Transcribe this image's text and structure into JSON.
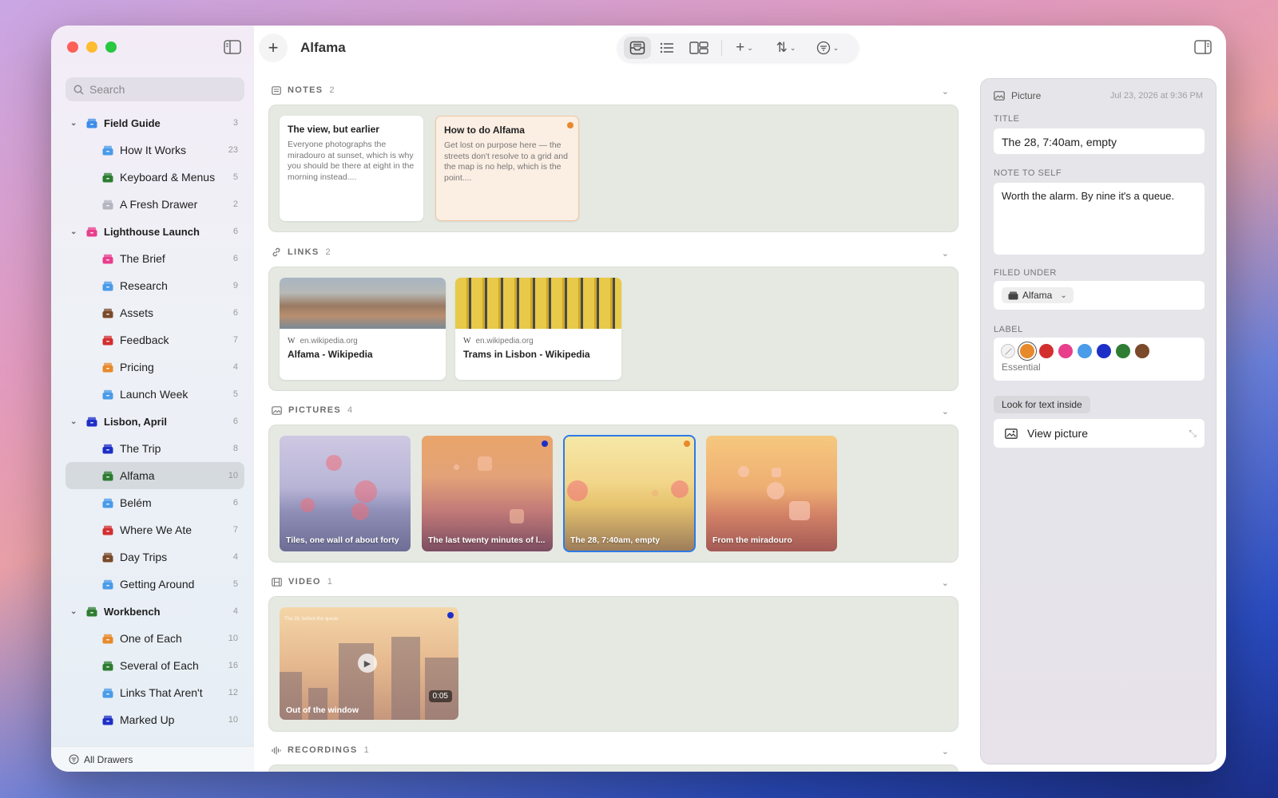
{
  "window": {
    "title": "Alfama"
  },
  "search": {
    "placeholder": "Search"
  },
  "sidebar": {
    "groups": [
      {
        "label": "Field Guide",
        "count": "3",
        "color": "#3d8ce8",
        "items": [
          {
            "label": "How It Works",
            "count": "23",
            "color": "#4a9be8"
          },
          {
            "label": "Keyboard & Menus",
            "count": "5",
            "color": "#2e7d32"
          },
          {
            "label": "A Fresh Drawer",
            "count": "2",
            "color": "#b5b5c0"
          }
        ]
      },
      {
        "label": "Lighthouse Launch",
        "count": "6",
        "color": "#e83e8c",
        "items": [
          {
            "label": "The Brief",
            "count": "6",
            "color": "#e83e8c"
          },
          {
            "label": "Research",
            "count": "9",
            "color": "#4a9be8"
          },
          {
            "label": "Assets",
            "count": "6",
            "color": "#7a4a2a"
          },
          {
            "label": "Feedback",
            "count": "7",
            "color": "#d32f2f"
          },
          {
            "label": "Pricing",
            "count": "4",
            "color": "#e8892b"
          },
          {
            "label": "Launch Week",
            "count": "5",
            "color": "#4a9be8"
          }
        ]
      },
      {
        "label": "Lisbon, April",
        "count": "6",
        "color": "#1e2fc8",
        "items": [
          {
            "label": "The Trip",
            "count": "8",
            "color": "#1e2fc8"
          },
          {
            "label": "Alfama",
            "count": "10",
            "color": "#2e7d32",
            "selected": true
          },
          {
            "label": "Belém",
            "count": "6",
            "color": "#4a9be8"
          },
          {
            "label": "Where We Ate",
            "count": "7",
            "color": "#d32f2f"
          },
          {
            "label": "Day Trips",
            "count": "4",
            "color": "#7a4a2a"
          },
          {
            "label": "Getting Around",
            "count": "5",
            "color": "#4a9be8"
          }
        ]
      },
      {
        "label": "Workbench",
        "count": "4",
        "color": "#2e7d32",
        "items": [
          {
            "label": "One of Each",
            "count": "10",
            "color": "#e8892b"
          },
          {
            "label": "Several of Each",
            "count": "16",
            "color": "#2e7d32"
          },
          {
            "label": "Links That Aren't",
            "count": "12",
            "color": "#4a9be8"
          },
          {
            "label": "Marked Up",
            "count": "10",
            "color": "#1e2fc8"
          }
        ]
      }
    ],
    "footer": "All Drawers"
  },
  "sections": {
    "notes": {
      "label": "NOTES",
      "count": "2"
    },
    "links": {
      "label": "LINKS",
      "count": "2"
    },
    "pictures": {
      "label": "PICTURES",
      "count": "4"
    },
    "video": {
      "label": "VIDEO",
      "count": "1"
    },
    "recordings": {
      "label": "RECORDINGS",
      "count": "1"
    }
  },
  "notes": [
    {
      "title": "The view, but earlier",
      "body": "Everyone photographs the miradouro at sunset, which is why you should be there at eight in the morning instead...."
    },
    {
      "title": "How to do Alfama",
      "body": "Get lost on purpose here — the streets don't resolve to a grid and the map is no help, which is the point....",
      "dot_color": "#e8892b"
    }
  ],
  "links": [
    {
      "domain": "en.wikipedia.org",
      "title": "Alfama - Wikipedia",
      "favicon": "W"
    },
    {
      "domain": "en.wikipedia.org",
      "title": "Trams in Lisbon - Wikipedia",
      "favicon": "W"
    }
  ],
  "pictures": [
    {
      "caption": "Tiles, one wall of about forty"
    },
    {
      "caption": "The last twenty minutes of l...",
      "dot_color": "#1e2fc8"
    },
    {
      "caption": "The 28, 7:40am, empty",
      "dot_color": "#e8892b",
      "selected": true
    },
    {
      "caption": "From the miradouro"
    }
  ],
  "video": {
    "caption": "Out of the window",
    "duration": "0:05",
    "overlay": "The 28, before the queue",
    "dot_color": "#1e2fc8"
  },
  "inspector": {
    "kind": "Picture",
    "date": "Jul 23, 2026 at 9:36 PM",
    "title_label": "TITLE",
    "title_value": "The 28, 7:40am, empty",
    "note_label": "NOTE TO SELF",
    "note_value": "Worth the alarm. By nine it's a queue.",
    "filed_label": "FILED UNDER",
    "filed_value": "Alfama",
    "label_label": "LABEL",
    "label_colors": [
      "#e8892b",
      "#d32f2f",
      "#e83e8c",
      "#4a9be8",
      "#1e2fc8",
      "#2e7d32",
      "#7a4a2a"
    ],
    "label_selected": "#e8892b",
    "label_name": "Essential",
    "ocr_button": "Look for text inside",
    "view_button": "View picture"
  }
}
